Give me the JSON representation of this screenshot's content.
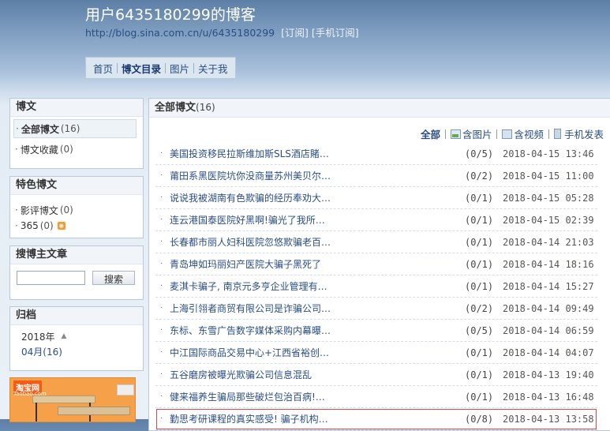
{
  "header": {
    "title": "用户6435180299的博客",
    "url": "http://blog.sina.com.cn/u/6435180299",
    "subscribe": "[订阅]",
    "mobile_subscribe": "[手机订阅]"
  },
  "nav": {
    "items": [
      {
        "label": "首页"
      },
      {
        "label": "博文目录"
      },
      {
        "label": "图片"
      },
      {
        "label": "关于我"
      }
    ]
  },
  "sidebar": {
    "posts_panel": {
      "title": "博文",
      "items": [
        {
          "label": "全部博文",
          "count": "(16)"
        },
        {
          "label": "博文收藏",
          "count": "(0)"
        }
      ]
    },
    "featured_panel": {
      "title": "特色博文",
      "items": [
        {
          "label": "影评博文",
          "count": "(0)"
        },
        {
          "label": "365",
          "count": "(0)"
        }
      ]
    },
    "search_panel": {
      "title": "搜博主文章",
      "input_value": "",
      "button": "搜索"
    },
    "archive_panel": {
      "title": "归档",
      "year": "2018年",
      "month": "04月(16)"
    },
    "ad": {
      "logo": "淘宝网",
      "sub": "Taobao.com"
    }
  },
  "main": {
    "title": "全部博文",
    "count": "(16)",
    "filters": [
      {
        "label": "全部"
      },
      {
        "label": "含图片"
      },
      {
        "label": "含视频"
      },
      {
        "label": "手机发表"
      }
    ],
    "posts": [
      {
        "title": "美国投资移民拉斯维加斯SLS酒店賭…",
        "comments": "(0/5)",
        "date": "2018-04-15 13:46"
      },
      {
        "title": "莆田系黑医院坑你没商量苏州美贝尔…",
        "comments": "(0/2)",
        "date": "2018-04-15 11:00"
      },
      {
        "title": "说说我被湖南有色欺骗的经历奉劝大…",
        "comments": "(0/1)",
        "date": "2018-04-15 05:28"
      },
      {
        "title": "连云港国泰医院好黑啊!骗光了我所…",
        "comments": "(0/1)",
        "date": "2018-04-15 02:39"
      },
      {
        "title": "长春都市丽人妇科医院忽悠欺骗老百…",
        "comments": "(0/1)",
        "date": "2018-04-14 21:03"
      },
      {
        "title": "青岛坤如玛丽妇产医院大骗子黑死了",
        "comments": "(0/1)",
        "date": "2018-04-14 18:16"
      },
      {
        "title": "麦淇卡骗子, 南京元多亨企业管理有…",
        "comments": "(0/1)",
        "date": "2018-04-14 15:27"
      },
      {
        "title": "上海引翎者商贸有限公司是诈骗公司…",
        "comments": "(0/2)",
        "date": "2018-04-14 09:49"
      },
      {
        "title": "东标、东雪广告数字媒体采购内幕曝…",
        "comments": "(0/5)",
        "date": "2018-04-14 06:59"
      },
      {
        "title": "中江国际商品交易中心+江西省裕创…",
        "comments": "(0/1)",
        "date": "2018-04-14 04:07"
      },
      {
        "title": "五谷磨房被曝光欺骗公司信息混乱",
        "comments": "(0/1)",
        "date": "2018-04-13 19:40"
      },
      {
        "title": "健来福养生骗局那些破烂包治百病!…",
        "comments": "(0/1)",
        "date": "2018-04-13 16:48"
      },
      {
        "title": "勤思考研课程的真实感受! 骗子机构…",
        "comments": "(0/8)",
        "date": "2018-04-13 13:58"
      }
    ]
  }
}
